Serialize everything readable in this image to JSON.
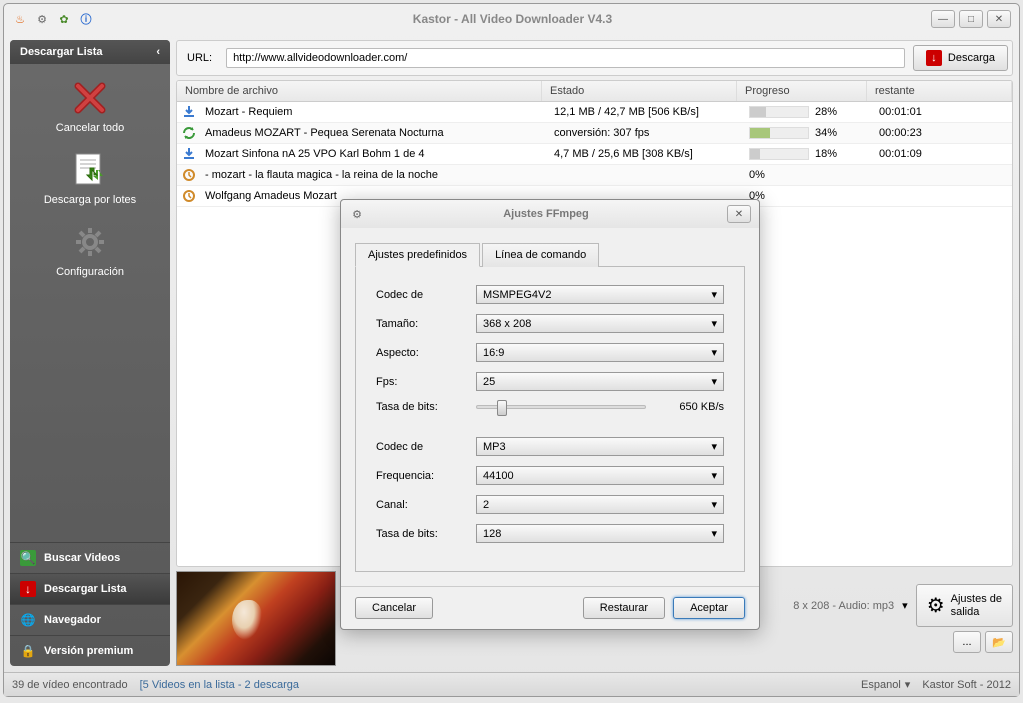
{
  "window": {
    "title": "Kastor - All Video Downloader V4.3"
  },
  "sidebar": {
    "header": "Descargar Lista",
    "tools": {
      "cancel_all": "Cancelar todo",
      "batch": "Descarga por lotes",
      "config": "Configuración"
    },
    "nav": {
      "search": "Buscar Videos",
      "download": "Descargar Lista",
      "browser": "Navegador",
      "premium": "Versión premium"
    }
  },
  "url": {
    "label": "URL:",
    "value": "http://www.allvideodownloader.com/",
    "button": "Descarga"
  },
  "table": {
    "headers": {
      "name": "Nombre de archivo",
      "state": "Estado",
      "progress": "Progreso",
      "remaining": "restante"
    },
    "rows": [
      {
        "icon": "download",
        "name": "Mozart - Requiem",
        "state": "12,1 MB / 42,7 MB [506 KB/s]",
        "progress": 28,
        "bar_color": "grey",
        "remaining": "00:01:01"
      },
      {
        "icon": "convert",
        "name": "Amadeus MOZART - Pequea Serenata Nocturna",
        "state": "conversión: 307 fps",
        "progress": 34,
        "bar_color": "green",
        "remaining": "00:00:23"
      },
      {
        "icon": "download",
        "name": "Mozart Sinfona nA 25 VPO Karl Bohm 1 de 4",
        "state": "4,7 MB / 25,6 MB [308 KB/s]",
        "progress": 18,
        "bar_color": "grey",
        "remaining": "00:01:09"
      },
      {
        "icon": "wait",
        "name": "- mozart - la flauta magica - la reina de la noche",
        "state": "",
        "progress": 0,
        "bar_color": "",
        "remaining": ""
      },
      {
        "icon": "wait",
        "name": "Wolfgang Amadeus Mozart",
        "state": "",
        "progress": 0,
        "bar_color": "",
        "remaining": ""
      }
    ]
  },
  "preview": {
    "format_text": "8 x 208 - Audio: mp3",
    "ajustes_btn": "Ajustes de\nsalida"
  },
  "status": {
    "left": "39 de vídeo encontrado",
    "mid": "[5 Videos en la lista - 2 descarga",
    "lang": "Espanol",
    "right": "Kastor Soft - 2012"
  },
  "dialog": {
    "title": "Ajustes FFmpeg",
    "tabs": {
      "presets": "Ajustes predefinidos",
      "cmdline": "Línea de comando"
    },
    "fields": {
      "codec_v_label": "Codec de",
      "codec_v_value": "MSMPEG4V2",
      "size_label": "Tamaño:",
      "size_value": "368 x 208",
      "aspect_label": "Aspecto:",
      "aspect_value": "16:9",
      "fps_label": "Fps:",
      "fps_value": "25",
      "bitrate_v_label": "Tasa de bits:",
      "bitrate_v_value": "650 KB/s",
      "codec_a_label": "Codec de",
      "codec_a_value": "MP3",
      "freq_label": "Frequencia:",
      "freq_value": "44100",
      "channel_label": "Canal:",
      "channel_value": "2",
      "bitrate_a_label": "Tasa de bits:",
      "bitrate_a_value": "128"
    },
    "buttons": {
      "cancel": "Cancelar",
      "restore": "Restaurar",
      "accept": "Aceptar"
    }
  }
}
